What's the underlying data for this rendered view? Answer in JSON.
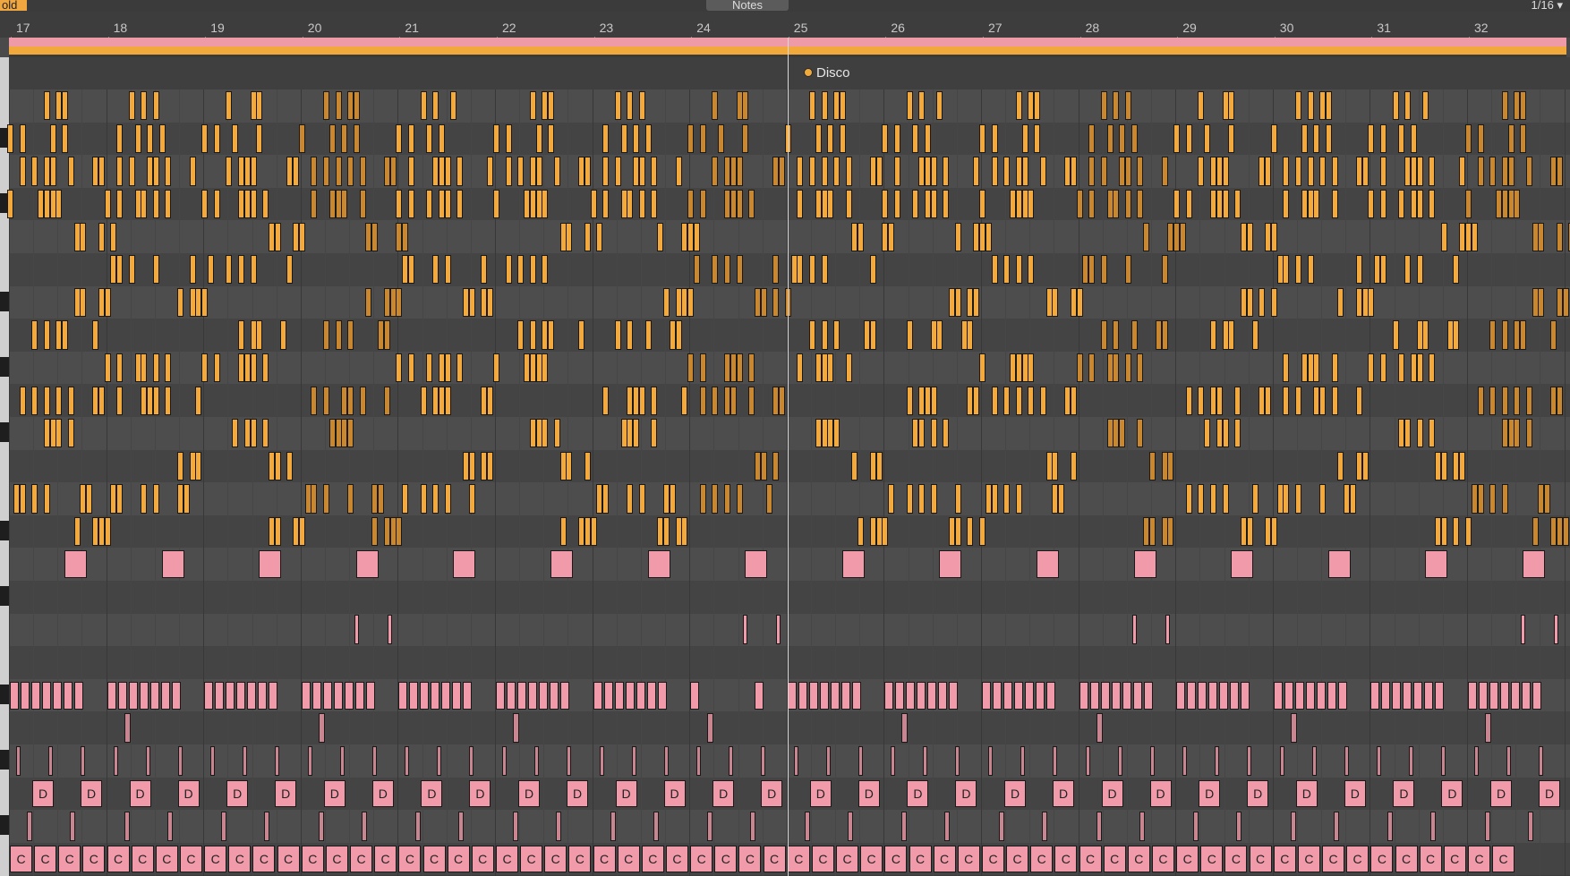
{
  "toolbar": {
    "fold_label": "old",
    "notes_tab_label": "Notes",
    "grid_quantization": "1/16 ▾"
  },
  "ruler": {
    "bars": [
      "17",
      "18",
      "19",
      "20",
      "21",
      "22",
      "23",
      "24",
      "25",
      "26",
      "27",
      "28",
      "29",
      "30",
      "31",
      "32"
    ]
  },
  "locator": {
    "name": "Disco"
  },
  "note_labels": {
    "d_row": "D",
    "c_row": "C"
  },
  "colors": {
    "clip_orange": "#f1a93b",
    "clip_pink": "#ef9aa7",
    "lane_light": "#4d4d4d",
    "lane_dark": "#444444",
    "playhead": "#d8d8d8"
  },
  "icons": {
    "locator_marker": "circle-marker-icon",
    "dropdown": "chevron-down-icon"
  }
}
